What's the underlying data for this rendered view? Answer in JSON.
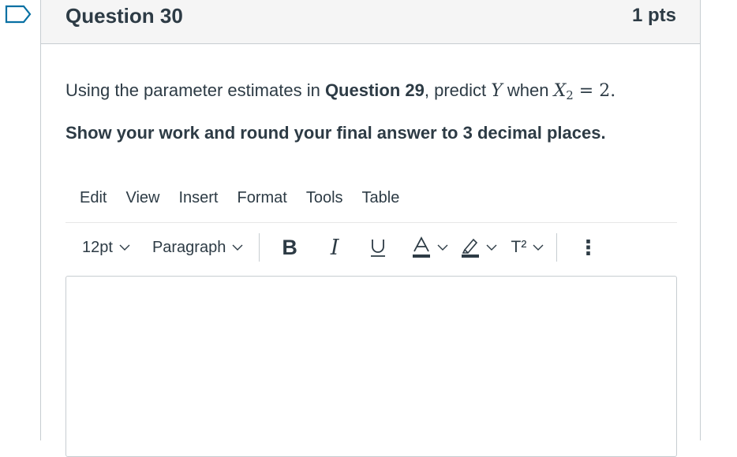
{
  "question": {
    "title": "Question 30",
    "points": "1 pts",
    "prompt_pre": "Using the parameter estimates in ",
    "prompt_ref": "Question 29",
    "prompt_mid": ", predict ",
    "var_y": "Y",
    "prompt_when": " when ",
    "var_x": "X",
    "var_x_sub": "2",
    "prompt_eq": " = 2.",
    "instruction": "Show your work and round your final answer to 3 decimal places."
  },
  "editor": {
    "menus": [
      "Edit",
      "View",
      "Insert",
      "Format",
      "Tools",
      "Table"
    ],
    "font_size": "12pt",
    "block_format": "Paragraph",
    "bold": "B",
    "italic": "I",
    "underline": "U",
    "text_color": "A",
    "superscript": "T²",
    "more": "⋮",
    "content": ""
  },
  "colors": {
    "accent": "#0770a3",
    "text": "#2d3b45",
    "border": "#c7cdd1",
    "header_bg": "#f5f5f5"
  }
}
